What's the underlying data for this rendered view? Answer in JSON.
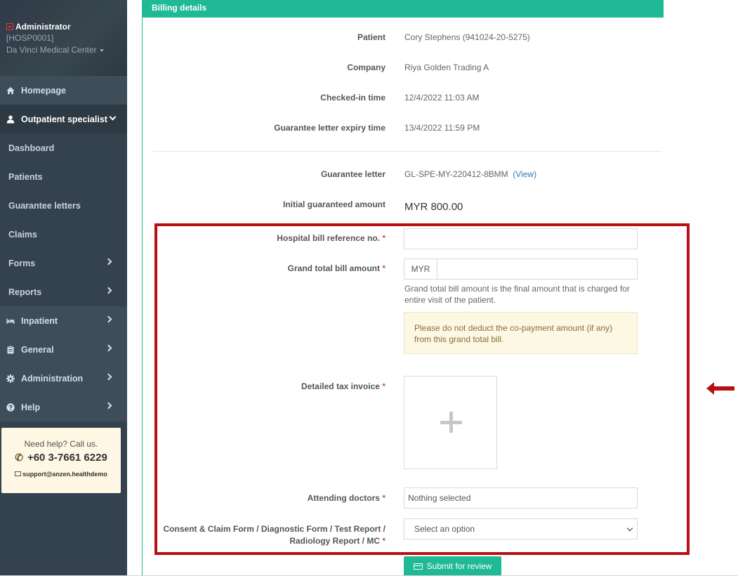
{
  "sidebar": {
    "user": {
      "name": "Administrator",
      "code": "[HOSP0001]",
      "center": "Da Vinci Medical Center"
    },
    "items": [
      {
        "label": "Homepage",
        "icon": "home-icon"
      },
      {
        "label": "Outpatient specialist",
        "icon": "user-icon"
      },
      {
        "label": "Dashboard"
      },
      {
        "label": "Patients"
      },
      {
        "label": "Guarantee letters"
      },
      {
        "label": "Claims"
      },
      {
        "label": "Forms"
      },
      {
        "label": "Reports"
      },
      {
        "label": "Inpatient",
        "icon": "bed-icon"
      },
      {
        "label": "General",
        "icon": "clipboard-icon"
      },
      {
        "label": "Administration",
        "icon": "gear-icon"
      },
      {
        "label": "Help",
        "icon": "question-icon"
      }
    ],
    "help": {
      "title": "Need help? Call us.",
      "phone": "+60 3-7661 6229",
      "email": "support@anzen.healthdemo"
    }
  },
  "panel": {
    "title": "Billing details",
    "patient_label": "Patient",
    "patient_value": "Cory Stephens (941024-20-5275)",
    "company_label": "Company",
    "company_value": "Riya Golden Trading A",
    "checkin_label": "Checked-in time",
    "checkin_value": "12/4/2022 11:03 AM",
    "gl_expiry_label": "Guarantee letter expiry time",
    "gl_expiry_value": "13/4/2022 11:59 PM",
    "gl_label": "Guarantee letter",
    "gl_value": "GL-SPE-MY-220412-8BMM",
    "gl_view": "(View)",
    "initial_label": "Initial guaranteed amount",
    "initial_value": "MYR 800.00"
  },
  "form": {
    "required_mark": "*",
    "bill_ref_label": "Hospital bill reference no.",
    "bill_ref_value": "",
    "grand_total_label": "Grand total bill amount",
    "currency": "MYR",
    "grand_total_value": "",
    "grand_total_hint": "Grand total bill amount is the final amount that is charged for entire visit of the patient.",
    "warning": "Please do not deduct the co-payment amount (if any) from this grand total bill.",
    "tax_invoice_label": "Detailed tax invoice",
    "doctors_label": "Attending doctors",
    "doctors_value": "Nothing selected",
    "consent_label_line1": "Consent & Claim Form / Diagnostic Form / Test Report /",
    "consent_label_line2": "Radiology Report / MC",
    "consent_value": "Select an option",
    "submit_label": "Submit for review"
  },
  "colors": {
    "sidebar": "#34424f",
    "accent": "#1fb996",
    "highlight": "#b80f14",
    "warning_bg": "#fcf8e3"
  }
}
